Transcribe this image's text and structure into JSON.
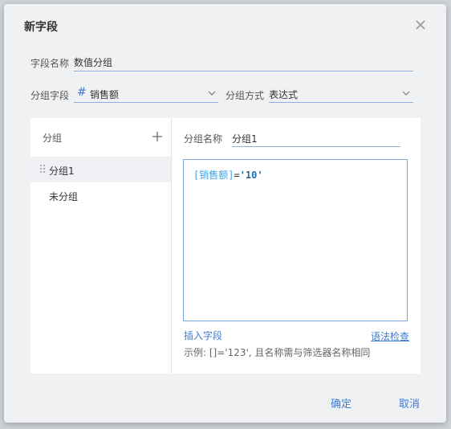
{
  "dialog": {
    "title": "新字段",
    "confirm_label": "确定",
    "cancel_label": "取消"
  },
  "field_name": {
    "label": "字段名称",
    "value": "数值分组"
  },
  "group_field": {
    "label": "分组字段",
    "type_icon": "#",
    "value": "销售额"
  },
  "group_method": {
    "label": "分组方式",
    "value": "表达式"
  },
  "groups": {
    "header": "分组",
    "items": [
      {
        "label": "分组1",
        "selected": true
      },
      {
        "label": "未分组",
        "selected": false
      }
    ]
  },
  "group_editor": {
    "name_label": "分组名称",
    "name_value": "分组1",
    "expression": {
      "field": "[销售额]",
      "operator": "=",
      "value": "'10'"
    },
    "insert_field_link": "插入字段",
    "syntax_check_link": "语法检查",
    "example_hint": "示例: []='123', 且名称需与筛选器名称相同"
  },
  "colors": {
    "accent": "#3e7bd3",
    "field_token": "#3fa3e0",
    "dialog_bg": "#f0f1f3"
  }
}
